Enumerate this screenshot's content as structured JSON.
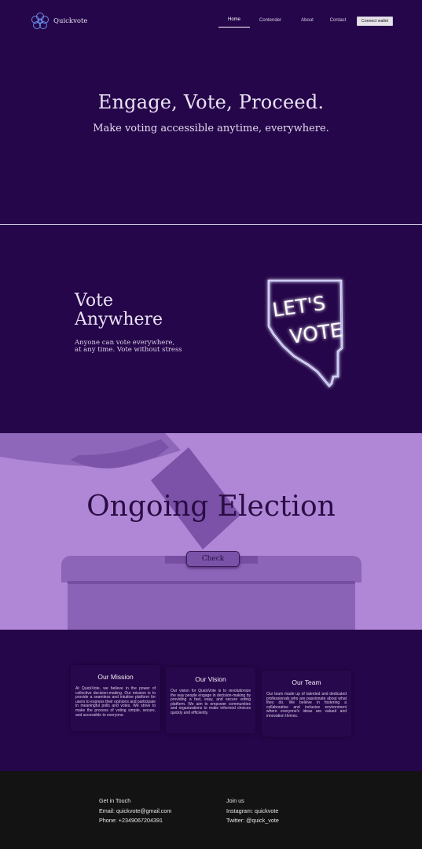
{
  "nav": {
    "brand": "Quickvote",
    "links": [
      "Home",
      "Contender",
      "About",
      "Contact"
    ],
    "connect_label": "Connect wallet"
  },
  "hero": {
    "title": "Engage, Vote, Proceed.",
    "subtitle": "Make voting accessible anytime, everywhere."
  },
  "vote": {
    "title_line1": "Vote",
    "title_line2": "Anywhere",
    "desc_line1": "Anyone can vote everywhere,",
    "desc_line2": "at any time. Vote without stress",
    "sign_line1": "LET'S",
    "sign_line2": "VOTE"
  },
  "election": {
    "title": "Ongoing Election",
    "check_label": "Check"
  },
  "cards": [
    {
      "title": "Our Mission",
      "text": "At QuickVote, we believe in the power of collective decision-making. Our mission is to provide a seamless and intuitive platform for users to express their opinions and participate in meaningful polls and votes. We strive to make the process of voting simple, secure, and accessible to everyone."
    },
    {
      "title": "Our Vision",
      "text": "Our vision for QuickVote is to revolutionize the way people engage in decision-making by providing a fast, easy, and secure voting platform. We aim to empower communities and organizations to make informed choices quickly and efficiently."
    },
    {
      "title": "Our Team",
      "text": "Our team made up of talented and dedicated professionals who are passionate about what they do. We believe in fostering a collaborative and inclusive environment where everyone's ideas are valued and innovation thrives."
    }
  ],
  "footer": {
    "get_in_touch": "Get in Touch",
    "email": "Email: quickvote@gmail.com",
    "phone": "Phone: +2349067204391",
    "join_us": "Join us",
    "instagram": "Instagram: quickvote",
    "twitter": "Twitter: @quick_vote"
  },
  "colors": {
    "background": "#26064a",
    "election_bg": "#b087d6",
    "footer_bg": "#131313",
    "accent": "#7a53a8"
  }
}
